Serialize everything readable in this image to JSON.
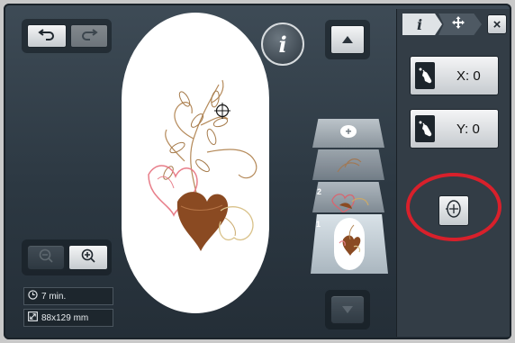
{
  "toolbar": {
    "undo_icon": "undo-arrow-icon",
    "redo_icon": "redo-arrow-icon"
  },
  "info_button": {
    "label": "i"
  },
  "zoom": {
    "zoom_out_icon": "zoom-out-icon",
    "zoom_in_icon": "zoom-in-icon"
  },
  "status": {
    "time": "7 min.",
    "size": "88x129 mm"
  },
  "layers": {
    "numbers": [
      "2",
      "1"
    ]
  },
  "sidebar": {
    "tab_info": "i",
    "tab_move_icon": "move-icon",
    "close_label": "×",
    "x_label": "X: 0",
    "y_label": "Y: 0"
  },
  "colors": {
    "highlight_ring": "#d8202b",
    "hoop": "#ffffff"
  }
}
